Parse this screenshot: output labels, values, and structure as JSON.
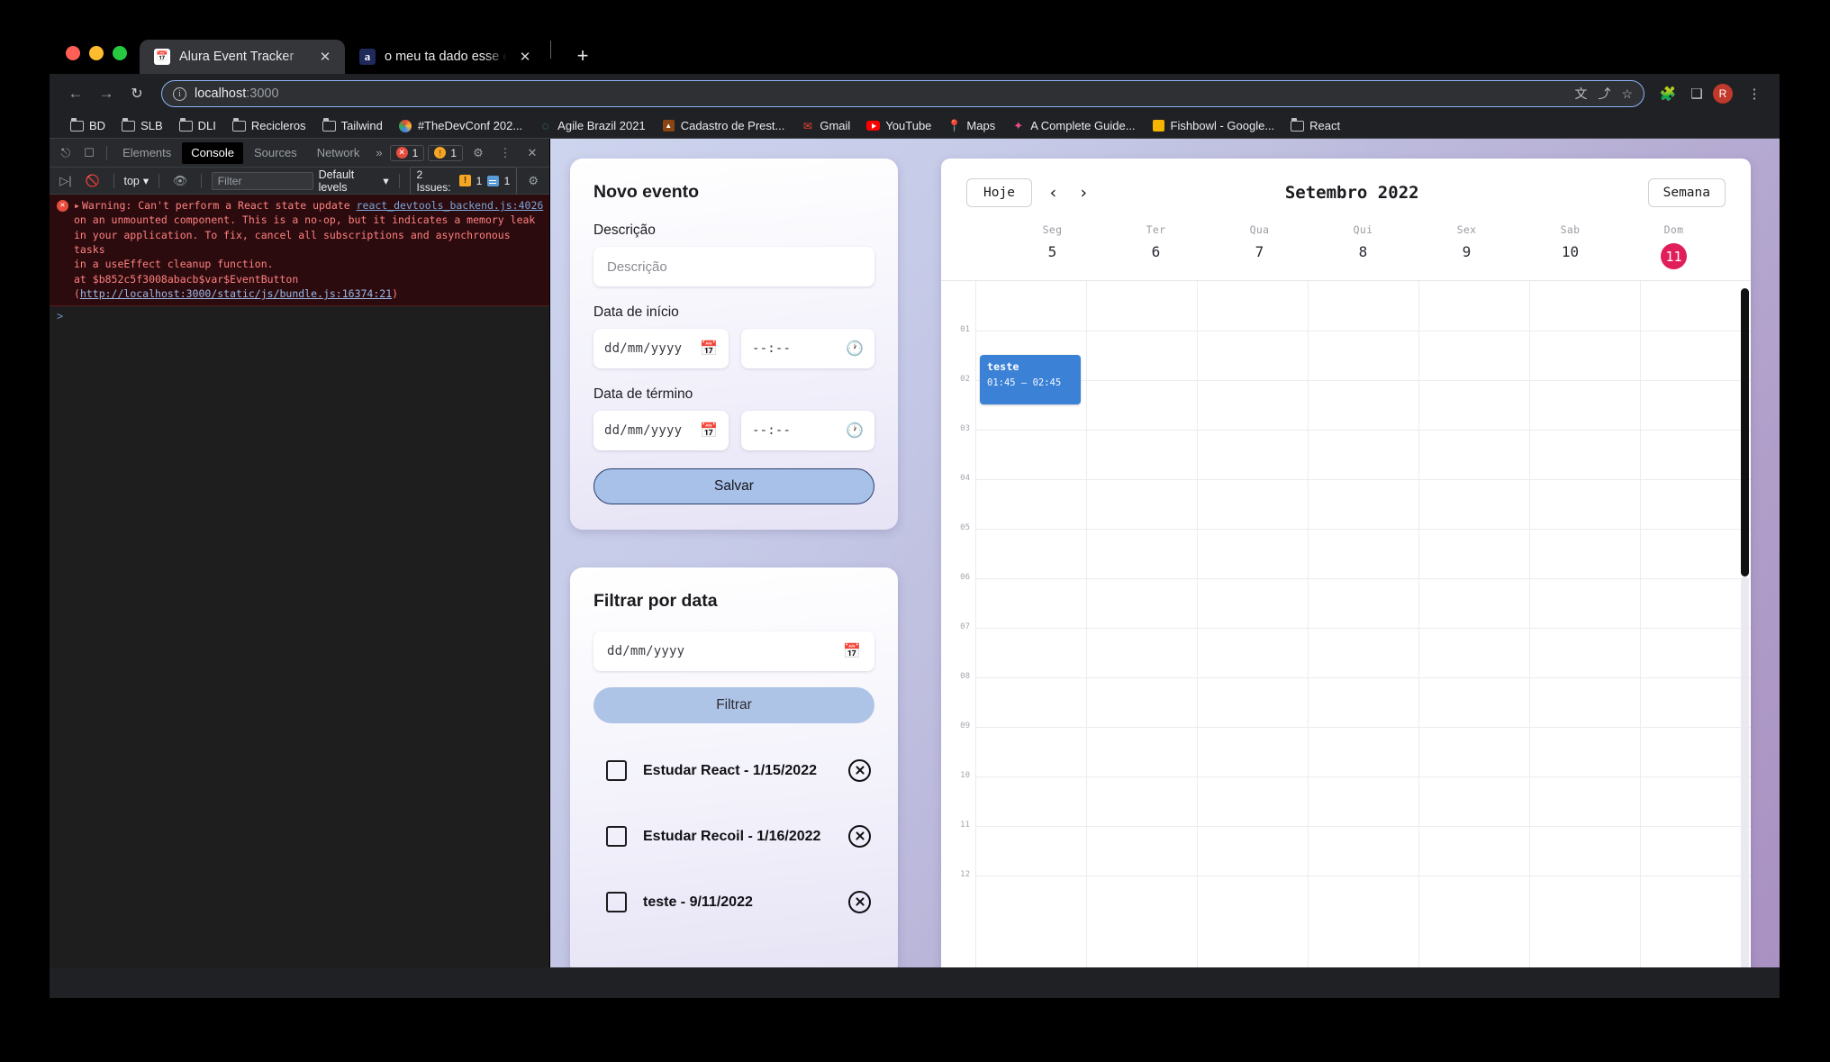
{
  "browser": {
    "tabs": [
      {
        "title": "Alura Event Tracker",
        "favicon": "calendar-icon",
        "active": true
      },
      {
        "title": "o meu ta dado esse erro aqui o",
        "favicon": "alura-icon",
        "active": false
      }
    ],
    "new_tab_label": "+",
    "close_label": "✕",
    "nav": {
      "back": "←",
      "forward": "→",
      "reload": "↻"
    },
    "omnibox": {
      "host": "localhost",
      "port": ":3000",
      "info_icon": "info-icon"
    },
    "omni_actions": {
      "translate": "文",
      "share": "⤴",
      "bookmark": "☆"
    },
    "toolbar_actions": {
      "extensions": "🧩",
      "sidepanel": "❑",
      "menu": "⋮"
    },
    "avatar_letter": "R",
    "bookmarks": [
      {
        "label": "BD",
        "icon": "folder-icon"
      },
      {
        "label": "SLB",
        "icon": "folder-icon"
      },
      {
        "label": "DLI",
        "icon": "folder-icon"
      },
      {
        "label": "Recicleros",
        "icon": "folder-icon"
      },
      {
        "label": "Tailwind",
        "icon": "folder-icon"
      },
      {
        "label": "#TheDevConf 202...",
        "icon": "globe-icon"
      },
      {
        "label": "Agile Brazil 2021",
        "icon": "agile-icon"
      },
      {
        "label": "Cadastro de Prest...",
        "icon": "site-icon"
      },
      {
        "label": "Gmail",
        "icon": "gmail-icon"
      },
      {
        "label": "YouTube",
        "icon": "youtube-icon"
      },
      {
        "label": "Maps",
        "icon": "maps-icon"
      },
      {
        "label": "A Complete Guide...",
        "icon": "star-icon"
      },
      {
        "label": "Fishbowl - Google...",
        "icon": "square-icon"
      },
      {
        "label": "React",
        "icon": "folder-icon"
      }
    ]
  },
  "devtools": {
    "tabs": [
      "Elements",
      "Console",
      "Sources",
      "Network"
    ],
    "active_tab": "Console",
    "more_label": "»",
    "error_count": "1",
    "warning_count": "1",
    "inspect_icon": "inspect-icon",
    "device_icon": "device-toolbar-icon",
    "settings_icon": "gear-icon",
    "kebab_icon": "kebab-menu-icon",
    "close_icon": "close-icon",
    "toolbar": {
      "execute_icon": "execute-icon",
      "clear_icon": "clear-console-icon",
      "context": "top",
      "eye_icon": "live-expression-icon",
      "filter_placeholder": "Filter",
      "levels": "Default levels",
      "issues_label": "2 Issues:",
      "issues_warning": "1",
      "issues_info": "1",
      "chevron": "▾"
    },
    "console_message": {
      "severity": "error",
      "line1_prefix": "Warning: Can't perform a React state update",
      "line1_link": "react_devtools_backend.js:4026",
      "line2": "on an unmounted component. This is a no-op, but it indicates a memory leak",
      "line3": "in your application. To fix, cancel all subscriptions and asynchronous tasks",
      "line4": "in a useEffect cleanup function.",
      "line5_prefix": "    at $b852c5f3008abacb$var$EventButton (",
      "line5_link": "http://localhost:3000/static/js/bundle.js:16374:21",
      "line5_suffix": ")"
    },
    "prompt": ">"
  },
  "app": {
    "new_event": {
      "title": "Novo evento",
      "description_label": "Descrição",
      "description_placeholder": "Descrição",
      "start_label": "Data de início",
      "end_label": "Data de término",
      "date_placeholder": "dd/mm/yyyy",
      "time_placeholder": "--:--",
      "save_label": "Salvar",
      "calendar_icon": "calendar-picker-icon",
      "clock_icon": "clock-picker-icon"
    },
    "filter": {
      "title": "Filtrar por data",
      "date_placeholder": "dd/mm/yyyy",
      "button_label": "Filtrar",
      "calendar_icon": "calendar-picker-icon"
    },
    "events": [
      {
        "label": "Estudar React - 1/15/2022",
        "checked": false
      },
      {
        "label": "Estudar Recoil - 1/16/2022",
        "checked": false
      },
      {
        "label": "teste - 9/11/2022",
        "checked": false
      }
    ],
    "calendar": {
      "today_label": "Hoje",
      "prev_icon": "‹",
      "next_icon": "›",
      "month_title": "Setembro 2022",
      "view_label": "Semana",
      "days": [
        {
          "dow": "Seg",
          "num": "5",
          "today": false
        },
        {
          "dow": "Ter",
          "num": "6",
          "today": false
        },
        {
          "dow": "Qua",
          "num": "7",
          "today": false
        },
        {
          "dow": "Qui",
          "num": "8",
          "today": false
        },
        {
          "dow": "Sex",
          "num": "9",
          "today": false
        },
        {
          "dow": "Sab",
          "num": "10",
          "today": false
        },
        {
          "dow": "Dom",
          "num": "11",
          "today": true
        }
      ],
      "hours": [
        "01",
        "02",
        "03",
        "04",
        "05",
        "06",
        "07",
        "08",
        "09",
        "10",
        "11",
        "12"
      ],
      "events": [
        {
          "title": "teste",
          "time_range": "01:45 – 02:45",
          "day_index": 0,
          "color": "#3b82d6"
        }
      ]
    }
  }
}
